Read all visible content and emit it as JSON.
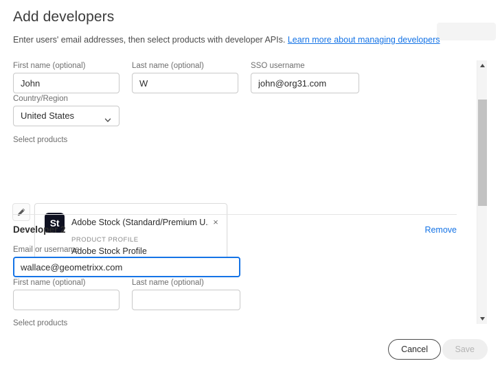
{
  "header": {
    "title": "Add developers",
    "subtitle_text": "Enter users' email addresses, then select products with developer APIs.",
    "link_label": "Learn more about managing developers"
  },
  "developer1": {
    "first_name": {
      "label": "First name (optional)",
      "value": "John"
    },
    "last_name": {
      "label": "Last name (optional)",
      "value": "W"
    },
    "sso_username": {
      "label": "SSO username",
      "value": "john@org31.com"
    },
    "country": {
      "label": "Country/Region",
      "value": "United States"
    },
    "select_products_label": "Select products",
    "product_card": {
      "icon_text": "St",
      "name": "Adobe Stock (Standard/Premium U...",
      "profile_label": "PRODUCT PROFILE",
      "profile_value": "Adobe Stock Profile",
      "close_label": "×"
    }
  },
  "developer2": {
    "heading": "Developer 2",
    "remove_label": "Remove",
    "email": {
      "label": "Email or username",
      "value": "wallace@geometrixx.com"
    },
    "first_name": {
      "label": "First name (optional)",
      "value": "",
      "placeholder": ""
    },
    "last_name": {
      "label": "Last name (optional)",
      "value": "",
      "placeholder": ""
    },
    "select_products_label": "Select products"
  },
  "footer": {
    "cancel_label": "Cancel",
    "save_label": "Save"
  },
  "colors": {
    "link_blue": "#1473e6",
    "focus_blue": "#1473e6",
    "product_icon_bg": "#0f1121",
    "text_primary": "#2c2c2c",
    "text_secondary": "#6e6e6e",
    "scrollbar_thumb": "#c2c2c2"
  }
}
